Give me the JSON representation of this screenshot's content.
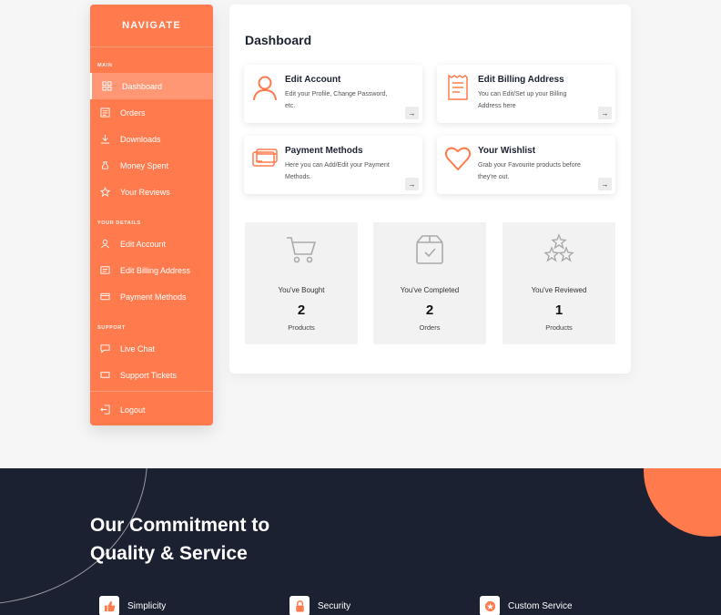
{
  "sidebar": {
    "title": "NAVIGATE",
    "sections": [
      {
        "title": "MAIN",
        "items": [
          {
            "label": "Dashboard",
            "icon": "dashboard-icon",
            "active": true
          },
          {
            "label": "Orders",
            "icon": "orders-icon"
          },
          {
            "label": "Downloads",
            "icon": "download-icon"
          },
          {
            "label": "Money Spent",
            "icon": "money-icon"
          },
          {
            "label": "Your Reviews",
            "icon": "star-icon"
          }
        ]
      },
      {
        "title": "YOUR DETAILS",
        "items": [
          {
            "label": "Edit Account",
            "icon": "user-icon"
          },
          {
            "label": "Edit Billing Address",
            "icon": "billing-icon"
          },
          {
            "label": "Payment Methods",
            "icon": "card-icon"
          }
        ]
      },
      {
        "title": "SUPPORT",
        "items": [
          {
            "label": "Live Chat",
            "icon": "chat-icon"
          },
          {
            "label": "Support Tickets",
            "icon": "ticket-icon"
          }
        ]
      }
    ],
    "logout": "Logout"
  },
  "main": {
    "title": "Dashboard",
    "cards": [
      {
        "title": "Edit Account",
        "desc": "Edit your Profile, Change Password, etc.",
        "icon": "user-icon"
      },
      {
        "title": "Edit Billing Address",
        "desc": "You can Edit/Set up your Billing Address here",
        "icon": "receipt-icon"
      },
      {
        "title": "Payment Methods",
        "desc": "Here you can Add/Edit your Payment Methods.",
        "icon": "credit-card-icon"
      },
      {
        "title": "Your Wishlist",
        "desc": "Grab your Favourite products before they're out.",
        "icon": "heart-icon"
      }
    ],
    "card_arrow": "→",
    "stats": [
      {
        "label": "You've Bought",
        "value": "2",
        "unit": "Products",
        "icon": "cart-icon"
      },
      {
        "label": "You've Completed",
        "value": "2",
        "unit": "Orders",
        "icon": "box-icon"
      },
      {
        "label": "You've Reviewed",
        "value": "1",
        "unit": "Products",
        "icon": "stars-icon"
      }
    ]
  },
  "footer": {
    "title": "Our Commitment to Quality & Service",
    "features": [
      {
        "label": "Simplicity",
        "icon": "thumbs-up-icon"
      },
      {
        "label": "Security",
        "icon": "lock-icon"
      },
      {
        "label": "Custom Service",
        "icon": "badge-icon"
      }
    ]
  },
  "colors": {
    "accent": "#ff7a4d",
    "footer_bg": "#1b2130",
    "stat_bg": "#f2f2f2"
  }
}
